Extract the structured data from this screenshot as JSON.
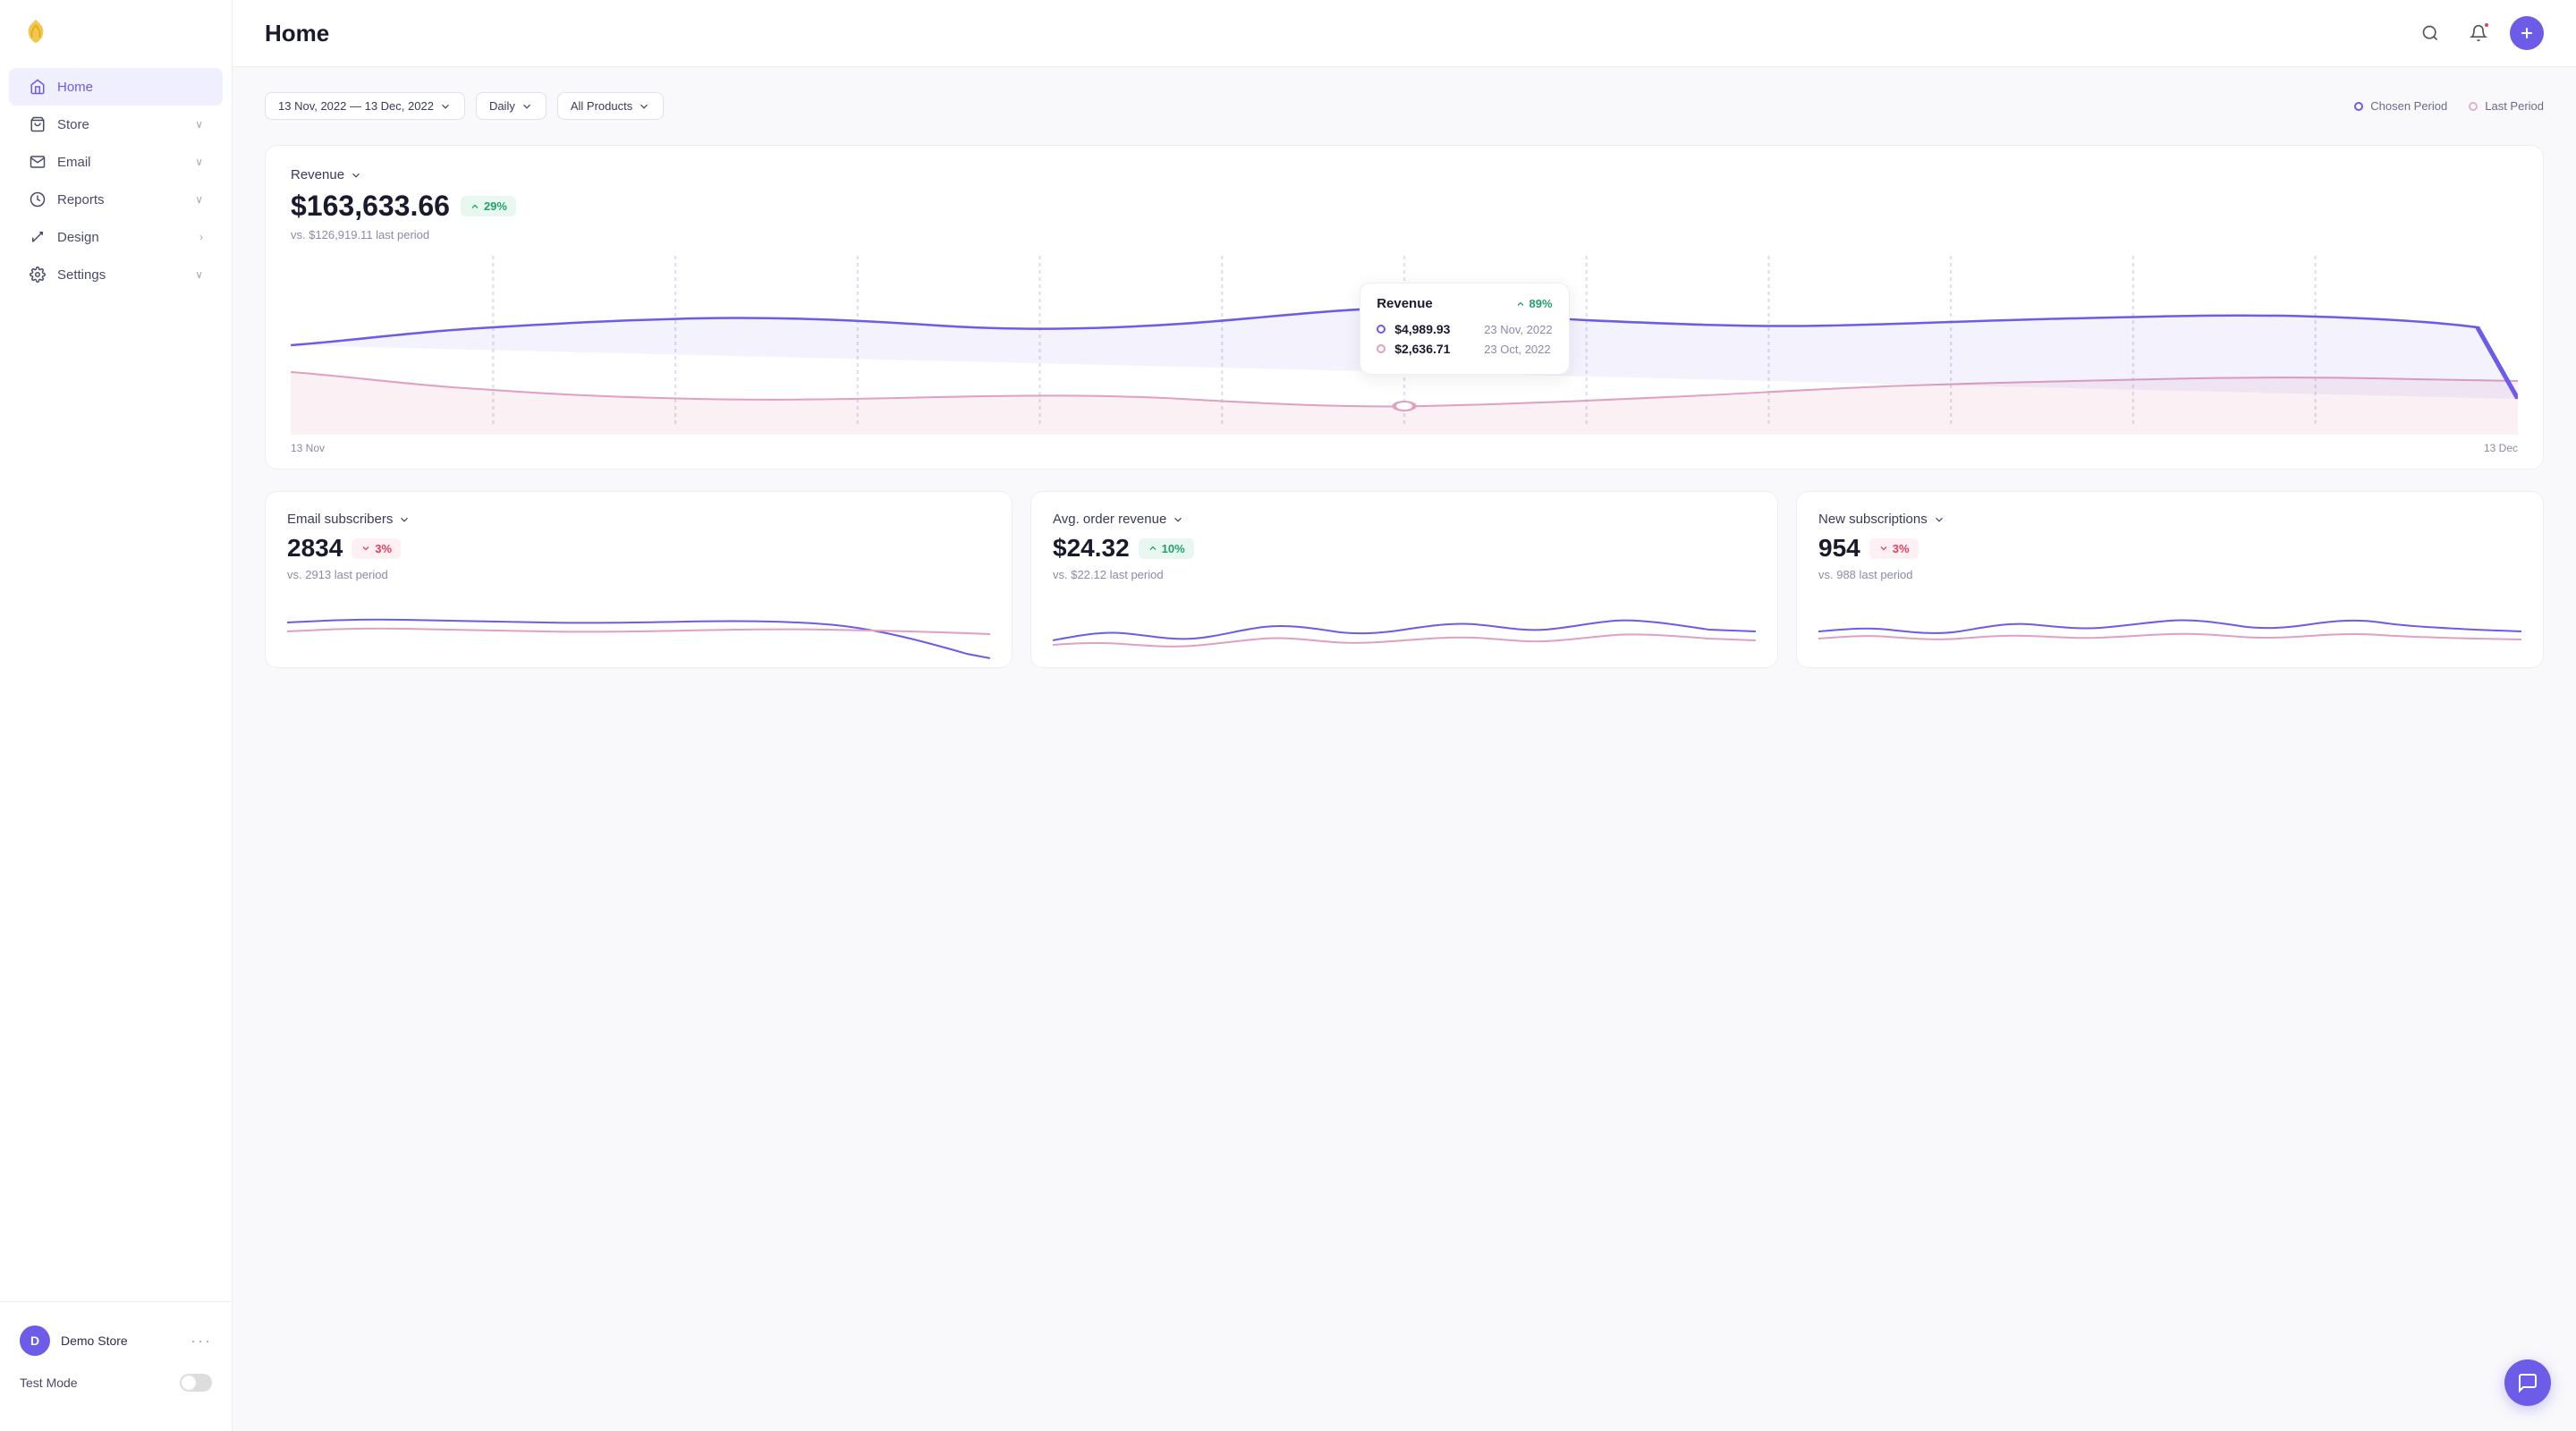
{
  "header": {
    "title": "Home",
    "icons": {
      "search": "🔍",
      "bell": "🔔",
      "add": "+"
    }
  },
  "sidebar": {
    "logo_icon": "🌿",
    "items": [
      {
        "id": "home",
        "label": "Home",
        "icon": "⌂",
        "active": true,
        "chevron": "∨"
      },
      {
        "id": "store",
        "label": "Store",
        "icon": "🛍",
        "active": false,
        "chevron": "∨"
      },
      {
        "id": "email",
        "label": "Email",
        "icon": "✉",
        "active": false,
        "chevron": "∨"
      },
      {
        "id": "reports",
        "label": "Reports",
        "icon": "⏱",
        "active": false,
        "chevron": "∨"
      },
      {
        "id": "design",
        "label": "Design",
        "icon": "↗",
        "active": false,
        "chevron": "›"
      },
      {
        "id": "settings",
        "label": "Settings",
        "icon": "⚙",
        "active": false,
        "chevron": "∨"
      }
    ],
    "store": {
      "name": "Demo Store",
      "initials": "D",
      "dots": "···"
    },
    "test_mode": {
      "label": "Test Mode",
      "enabled": false
    }
  },
  "toolbar": {
    "date_range": "13 Nov, 2022 — 13 Dec, 2022",
    "frequency": "Daily",
    "product_filter": "All Products",
    "legend_chosen": "Chosen Period",
    "legend_last": "Last Period"
  },
  "revenue": {
    "label": "Revenue",
    "value": "$163,633.66",
    "badge_pct": "29%",
    "badge_dir": "up",
    "sub": "vs. $126,919.11 last period",
    "chart_start_label": "13 Nov",
    "chart_end_label": "13 Dec",
    "tooltip": {
      "title": "Revenue",
      "pct": "89%",
      "dir": "up",
      "row1_val": "$4,989.93",
      "row1_date": "23 Nov, 2022",
      "row2_val": "$2,636.71",
      "row2_date": "23 Oct, 2022"
    }
  },
  "mini_cards": [
    {
      "id": "email-subscribers",
      "label": "Email subscribers",
      "value": "2834",
      "badge_pct": "3%",
      "badge_dir": "down",
      "sub": "vs. 2913 last period"
    },
    {
      "id": "avg-order-revenue",
      "label": "Avg. order revenue",
      "value": "$24.32",
      "badge_pct": "10%",
      "badge_dir": "up",
      "sub": "vs. $22.12 last period"
    },
    {
      "id": "new-subscriptions",
      "label": "New subscriptions",
      "value": "954",
      "badge_pct": "3%",
      "badge_dir": "down",
      "sub": "vs. 988 last period"
    }
  ],
  "chat_btn": "💬"
}
